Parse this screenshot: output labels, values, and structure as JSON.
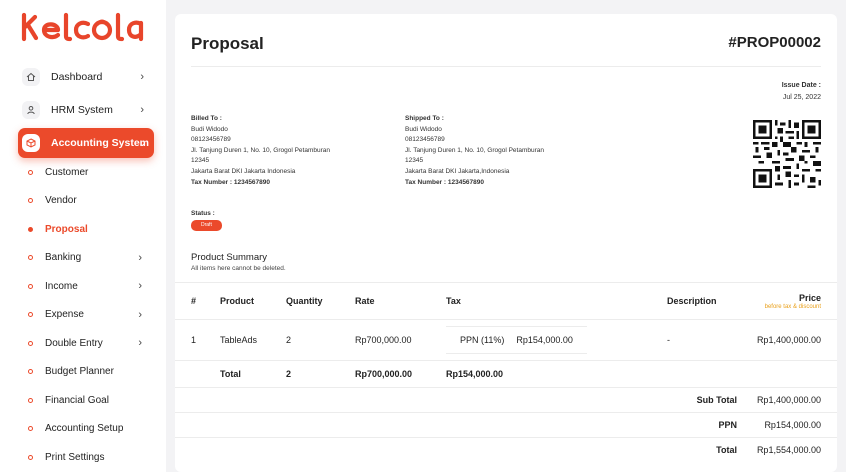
{
  "brand": {
    "logo_text": "KELCOLA"
  },
  "sidebar": {
    "items": [
      {
        "label": "Dashboard",
        "icon": "home-icon",
        "chevron": "›"
      },
      {
        "label": "HRM System",
        "icon": "user-icon",
        "chevron": "›"
      },
      {
        "label": "Accounting System",
        "icon": "box-icon",
        "chevron": "⌄"
      }
    ],
    "subitems": [
      {
        "label": "Customer"
      },
      {
        "label": "Vendor"
      },
      {
        "label": "Proposal"
      },
      {
        "label": "Banking",
        "chevron": "›"
      },
      {
        "label": "Income",
        "chevron": "›"
      },
      {
        "label": "Expense",
        "chevron": "›"
      },
      {
        "label": "Double Entry",
        "chevron": "›"
      },
      {
        "label": "Budget Planner"
      },
      {
        "label": "Financial Goal"
      },
      {
        "label": "Accounting Setup"
      },
      {
        "label": "Print Settings"
      }
    ]
  },
  "proposal": {
    "title": "Proposal",
    "number": "#PROP00002",
    "issue_label": "Issue Date :",
    "issue_date": "Jul 25, 2022",
    "billed": {
      "label": "Billed To :",
      "name": "Budi Widodo",
      "phone": "08123456789",
      "address": "Jl. Tanjung Duren 1, No. 10, Grogol Petamburan",
      "zip": "12345",
      "city": "Jakarta Barat DKI Jakarta Indonesia",
      "tax": "Tax Number : 1234567890"
    },
    "shipped": {
      "label": "Shipped To :",
      "name": "Budi Widodo",
      "phone": "08123456789",
      "address": "Jl. Tanjung Duren 1, No. 10, Grogol Petamburan",
      "zip": "12345",
      "city": "Jakarta Barat DKI Jakarta,Indonesia",
      "tax": "Tax Number : 1234567890"
    },
    "status_label": "Status :",
    "status_value": "Draft",
    "summary_title": "Product Summary",
    "summary_note": "All items here cannot be deleted."
  },
  "table": {
    "headers": {
      "num": "#",
      "product": "Product",
      "quantity": "Quantity",
      "rate": "Rate",
      "tax": "Tax",
      "description": "Description",
      "price": "Price",
      "price_note": "before tax & discount"
    },
    "row": {
      "num": "1",
      "product": "TableAds",
      "quantity": "2",
      "rate": "Rp700,000.00",
      "tax_name": "PPN (11%)",
      "tax_amount": "Rp154,000.00",
      "description": "-",
      "price": "Rp1,400,000.00"
    },
    "total": {
      "label": "Total",
      "quantity": "2",
      "rate": "Rp700,000.00",
      "tax": "Rp154,000.00"
    },
    "summary": [
      {
        "label": "Sub Total",
        "value": "Rp1,400,000.00"
      },
      {
        "label": "PPN",
        "value": "Rp154,000.00"
      },
      {
        "label": "Total",
        "value": "Rp1,554,000.00"
      }
    ]
  },
  "colors": {
    "accent": "#eb4a2b",
    "note": "#e9a01b"
  }
}
